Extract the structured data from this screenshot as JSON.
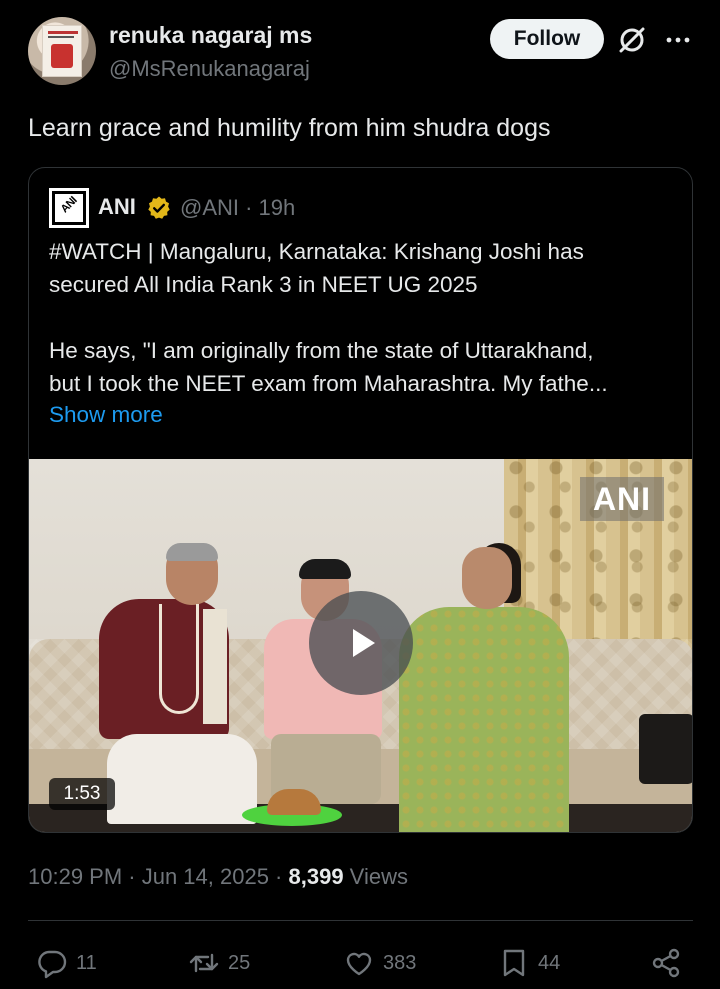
{
  "author": {
    "name": "renuka nagaraj ms",
    "handle": "@MsRenukanagaraj",
    "avatar_icon": "profile-photo"
  },
  "follow_label": "Follow",
  "tweet_text": "Learn grace and humility from him shudra dogs",
  "quote": {
    "name": "ANI",
    "handle_time": "@ANI · 19h",
    "logo_text": "ANI",
    "lines": [
      "#WATCH | Mangaluru, Karnataka: Krishang Joshi has",
      "secured All India Rank 3 in NEET UG 2025",
      "He says, \"I am originally from the state of Uttarakhand,",
      "but I took the NEET exam from Maharashtra. My fathe..."
    ],
    "show_more": "Show more",
    "media": {
      "watermark": "ANI",
      "duration": "1:53"
    }
  },
  "meta": {
    "timestamp": "10:29 PM · Jun 14, 2025 · ",
    "views_count": "8,399",
    "views_label": " Views"
  },
  "actions": {
    "replies": "11",
    "reposts": "25",
    "likes": "383",
    "bookmarks": "44"
  },
  "colors": {
    "background": "#000000",
    "text": "#e7e9ea",
    "muted": "#71767b",
    "link": "#1d9bf0",
    "verified": "#e2b719"
  }
}
